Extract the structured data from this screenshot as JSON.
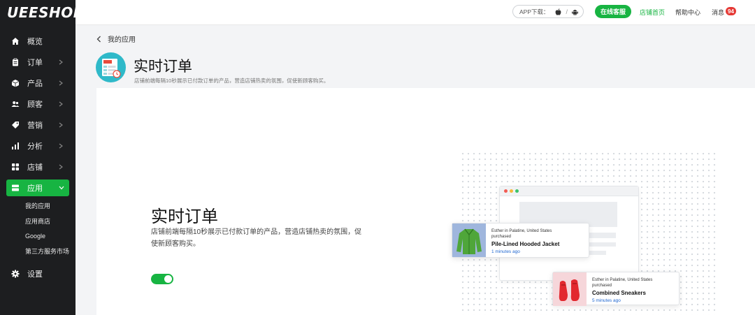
{
  "brand": {
    "logo_text": "UEESHOP",
    "accent_color": "#17b442"
  },
  "sidebar": {
    "items": [
      {
        "label": "概览",
        "icon": "home-icon"
      },
      {
        "label": "订单",
        "icon": "clipboard-icon"
      },
      {
        "label": "产品",
        "icon": "box-icon"
      },
      {
        "label": "顾客",
        "icon": "users-icon"
      },
      {
        "label": "营销",
        "icon": "tag-icon"
      },
      {
        "label": "分析",
        "icon": "bar-chart-icon"
      },
      {
        "label": "店铺",
        "icon": "grid-icon"
      },
      {
        "label": "应用",
        "icon": "app-icon"
      }
    ],
    "sub_items": [
      {
        "label": "我的应用"
      },
      {
        "label": "应用商店"
      },
      {
        "label": "Google"
      },
      {
        "label": "第三方服务市场"
      }
    ],
    "settings_label": "设置"
  },
  "topbar": {
    "app_download_label": "APP下载：",
    "app_download_sep": "/",
    "support_button": "在线客服",
    "store_home": "店铺首页",
    "help_center": "帮助中心",
    "messages": "消息",
    "messages_count": "94"
  },
  "header": {
    "breadcrumb": "我的应用",
    "title": "实时订单",
    "description": "店铺前端每隔10秒展示已付款订单的产品，营造店铺热卖的氛围，促使新顾客购买。"
  },
  "feature": {
    "title": "实时订单",
    "description": "店铺前端每隔10秒展示已付款订单的产品，营造店铺热卖的氛围，促使新顾客购买。",
    "enabled": true
  },
  "notifications": [
    {
      "who": "Esther in Palatine, United States purchased",
      "product": "Pile-Lined Hooded Jacket",
      "time": "1 minutes ago"
    },
    {
      "who": "Esther in Palatine, United States purchased",
      "product": "Combined Sneakers",
      "time": "5 minutes ago"
    }
  ]
}
